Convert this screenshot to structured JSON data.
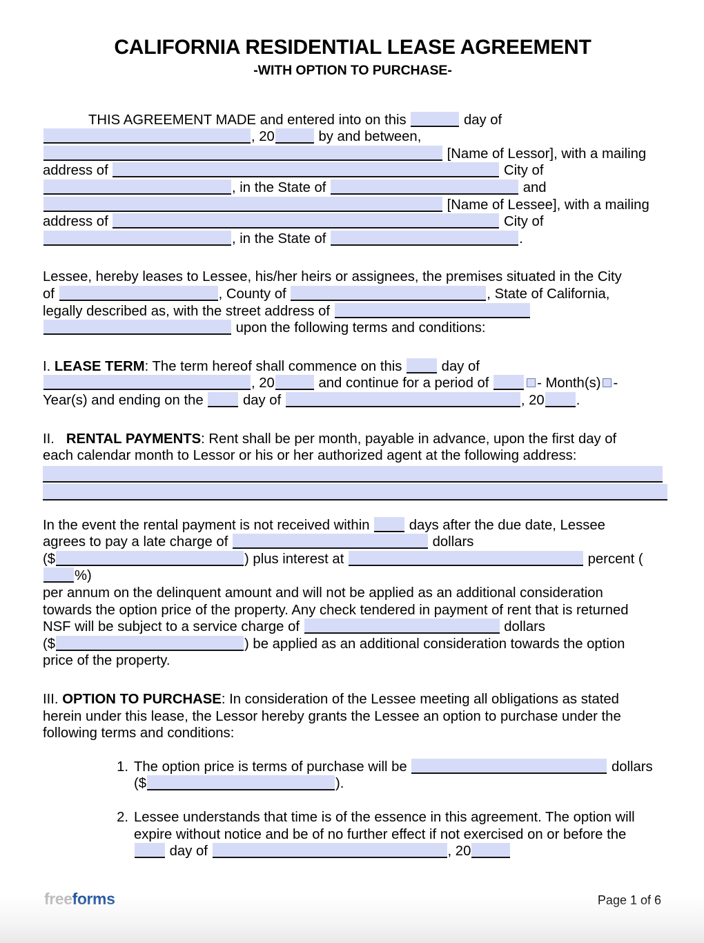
{
  "document": {
    "title": "CALIFORNIA RESIDENTIAL LEASE AGREEMENT",
    "subtitle": "-WITH OPTION TO PURCHASE-"
  },
  "colors": {
    "blank_fill": "#d6dcf7",
    "blank_underline": "#121212",
    "brand_free": "#b8b8b8",
    "brand_forms": "#1b4f9c"
  },
  "intro": {
    "t1": "THIS AGREEMENT MADE and entered into on this",
    "t2": "day of",
    "t3": ", 20",
    "t4": "by and between,",
    "t5": "[Name of Lessor], with a mailing",
    "t6": "address of",
    "t7": "City of",
    "t8": ", in the State of",
    "t9": "and",
    "t10": "[Name of Lessee], with a mailing",
    "t11": "address of",
    "t12": "City of",
    "t13": ", in the State of",
    "t14": "."
  },
  "premises": {
    "t1": "Lessee, hereby leases to Lessee, his/her heirs or assignees, the premises situated in the City",
    "t2": "of",
    "t3": ", County of",
    "t4": ", State of California,",
    "t5": "legally described as, with the street address of",
    "t6": "upon the following terms and conditions:"
  },
  "section_lease_term": {
    "number": "I.",
    "heading": "LEASE TERM",
    "t1": ": The term hereof shall commence on this",
    "t2": "day of",
    "t3": ", 20",
    "t4": "and continue for a period of",
    "t5": "- Month(s)",
    "t6": "-",
    "t7": "Year(s) and ending on the",
    "t8": "day of",
    "t9": ", 20",
    "t10": "."
  },
  "section_rental_payments": {
    "number": "II.",
    "heading": "RENTAL PAYMENTS",
    "t1": ": Rent shall be per month, payable in advance, upon the first day of",
    "t2": "each calendar month to Lessor or his or her authorized agent at the following address:",
    "late": {
      "t1": "In the event the rental payment is not received within",
      "t2": "days after the due date, Lessee",
      "t3": "agrees to pay a late charge of",
      "t4": "dollars",
      "t5": "($",
      "t6": ") plus interest at",
      "t7": "percent (",
      "t8": "%)",
      "t9": "per annum on the delinquent amount and will not be applied as an additional consideration",
      "t10": "towards the option price of the property. Any check tendered in payment of rent that is returned",
      "t11": "NSF will be subject to a service charge of",
      "t12": "dollars",
      "t13": "($",
      "t14": ") be applied as an additional consideration towards the option",
      "t15": "price of the property."
    }
  },
  "section_option_to_purchase": {
    "number": "III.",
    "heading": "OPTION TO PURCHASE",
    "t1": ":  In consideration of the Lessee meeting all obligations as stated",
    "t2": "herein under this lease, the Lessor hereby grants the Lessee an option to purchase under the",
    "t3": "following terms and conditions:",
    "items": [
      {
        "number": "1.",
        "t1": "The option price is terms of purchase will be",
        "t2": "dollars",
        "t3": "($",
        "t4": ")."
      },
      {
        "number": "2.",
        "t1": "Lessee understands that time is of the essence in this agreement. The option will",
        "t2": "expire without notice and be of no further effect if not exercised on or before the",
        "t3": "day of",
        "t4": ", 20"
      }
    ]
  },
  "footer": {
    "brand_free": "free",
    "brand_forms": "forms",
    "page_label": "Page 1 of 6"
  }
}
